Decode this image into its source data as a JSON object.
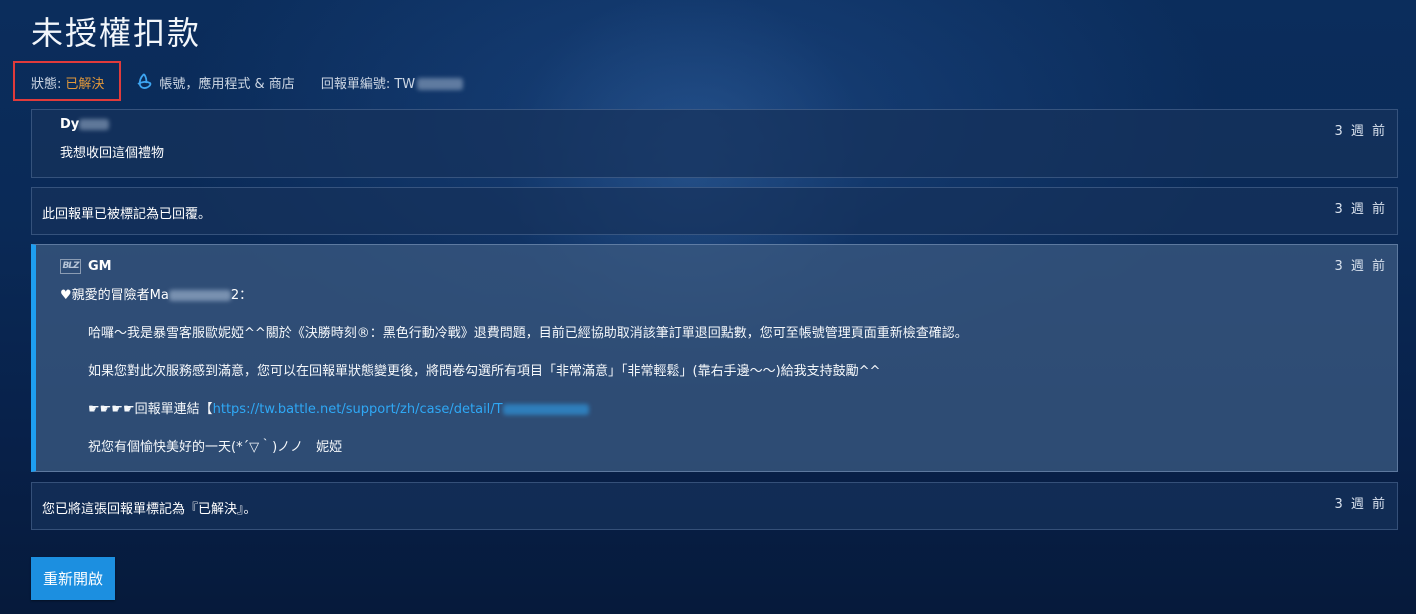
{
  "page": {
    "title": "未授權扣款"
  },
  "meta": {
    "status_label": "狀態:",
    "status_value": "已解決",
    "category": "帳號，應用程式 & 商店",
    "case_label": "回報單編號: TW"
  },
  "messages": [
    {
      "author": "Dy",
      "text": "我想收回這個禮物",
      "time": "3 週 前"
    },
    {
      "text": "此回報單已被標記為已回覆。",
      "time": "3 週 前"
    },
    {
      "author": "GM",
      "time": "3 週 前",
      "greeting": "♥親愛的冒險者Ma",
      "greeting_end": "2：",
      "p1": "哈囉～我是暴雪客服歐妮婭^^關於《決勝時刻®：黑色行動冷戰》退費問題，目前已經協助取消該筆訂單退回點數，您可至帳號管理頁面重新檢查確認。",
      "p2": "如果您對此次服務感到滿意，您可以在回報單狀態變更後，將問卷勾選所有項目「非常滿意」「非常輕鬆」(靠右手邊～～)給我支持鼓勵^^",
      "p3_prefix": "☛☛☛☛回報單連結【",
      "p3_link": "https://tw.battle.net/support/zh/case/detail/T",
      "p4": "祝您有個愉快美好的一天(*´▽｀)ノノ　妮婭"
    },
    {
      "text": "您已將這張回報單標記為『已解決』。",
      "time": "3 週 前"
    }
  ],
  "actions": {
    "reopen_label": "重新開啟"
  },
  "icons": {
    "category": "battlenet-icon",
    "gm_badge": "blizzard-logo-icon"
  },
  "colors": {
    "status": "#e0973a",
    "link": "#2fa8f5",
    "accent": "#1e9ef0",
    "button": "#1c8fe0",
    "highlight_box": "#e03b3b"
  }
}
